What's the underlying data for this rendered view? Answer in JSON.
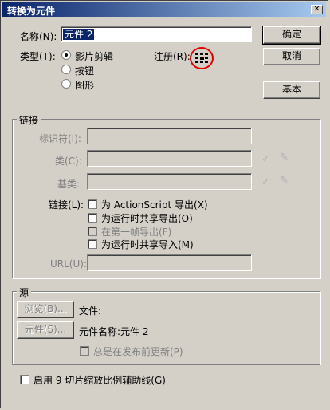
{
  "window": {
    "title": "转换为元件"
  },
  "name_label": "名称(N):",
  "name_value": "元件 2",
  "type_label": "类型(T):",
  "type_options": [
    "影片剪辑",
    "按钮",
    "图形"
  ],
  "registration_label": "注册(R):",
  "buttons": {
    "ok": "确定",
    "cancel": "取消",
    "basic": "基本"
  },
  "linkage_group": {
    "title": "链接",
    "identifier_label": "标识符(I):",
    "class_label": "类(C):",
    "base_class_label": "基类:",
    "linkage_label": "链接(L):",
    "options": [
      "为 ActionScript 导出(X)",
      "为运行时共享导出(O)",
      "在第一帧导出(F)",
      "为运行时共享导入(M)"
    ],
    "url_label": "URL(U):"
  },
  "source_group": {
    "title": "源",
    "browse_button": "浏览(B)...",
    "file_label": "文件:",
    "symbol_button": "元件(S)...",
    "symbol_name": "元件名称:元件 2",
    "always_update": "总是在发布前更新(P)"
  },
  "nine_slice": "启用 9 切片缩放比例辅助线(G)",
  "colors": {
    "titlebar": "#0a246a",
    "highlight": "#e00000"
  }
}
